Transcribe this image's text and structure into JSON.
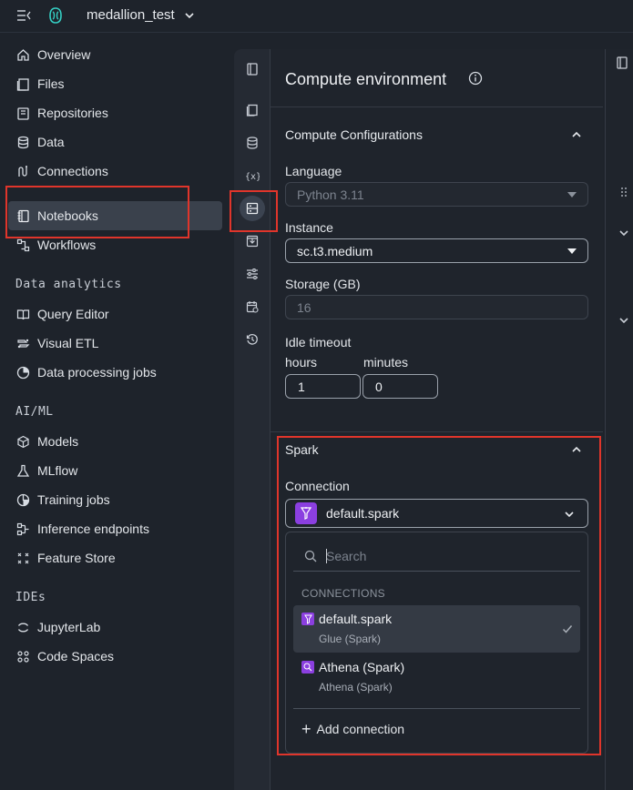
{
  "topbar": {
    "project_name": "medallion_test"
  },
  "nav": {
    "items": [
      {
        "label": "Overview",
        "icon": "home-icon"
      },
      {
        "label": "Files",
        "icon": "file-icon"
      },
      {
        "label": "Repositories",
        "icon": "repo-icon"
      },
      {
        "label": "Data",
        "icon": "database-icon"
      },
      {
        "label": "Connections",
        "icon": "connections-icon"
      },
      {
        "label": "Notebooks",
        "icon": "notebook-icon"
      },
      {
        "label": "Workflows",
        "icon": "workflow-icon"
      }
    ],
    "data_analytics_title": "Data analytics",
    "data_analytics": [
      {
        "label": "Query Editor",
        "icon": "book-icon"
      },
      {
        "label": "Visual ETL",
        "icon": "etl-icon"
      },
      {
        "label": "Data processing jobs",
        "icon": "jobs-icon"
      }
    ],
    "aiml_title": "AI/ML",
    "aiml": [
      {
        "label": "Models",
        "icon": "cube-icon"
      },
      {
        "label": "MLflow",
        "icon": "flask-icon"
      },
      {
        "label": "Training jobs",
        "icon": "training-icon"
      },
      {
        "label": "Inference endpoints",
        "icon": "endpoint-icon"
      },
      {
        "label": "Feature Store",
        "icon": "feature-store-icon"
      }
    ],
    "ides_title": "IDEs",
    "ides": [
      {
        "label": "JupyterLab",
        "icon": "jupyter-icon"
      },
      {
        "label": "Code Spaces",
        "icon": "code-spaces-icon"
      }
    ]
  },
  "panel": {
    "title": "Compute environment",
    "config_title": "Compute Configurations",
    "language_label": "Language",
    "language_value": "Python 3.11",
    "instance_label": "Instance",
    "instance_value": "sc.t3.medium",
    "storage_label": "Storage (GB)",
    "storage_value": "16",
    "idle_label": "Idle timeout",
    "hours_label": "hours",
    "minutes_label": "minutes",
    "hours_value": "1",
    "minutes_value": "0",
    "spark_title": "Spark",
    "connection_label": "Connection",
    "connection_value": "default.spark"
  },
  "dropdown": {
    "search_placeholder_first": "S",
    "search_placeholder_rest": "earch",
    "header": "CONNECTIONS",
    "options": [
      {
        "title": "default.spark",
        "subtitle": "Glue (Spark)",
        "selected": true
      },
      {
        "title": "Athena (Spark)",
        "subtitle": "Athena (Spark)",
        "selected": false
      }
    ],
    "add_label": "Add connection"
  },
  "colors": {
    "accent": "#8b3fe0",
    "highlight": "#e0352b",
    "background": "#1e232b"
  }
}
